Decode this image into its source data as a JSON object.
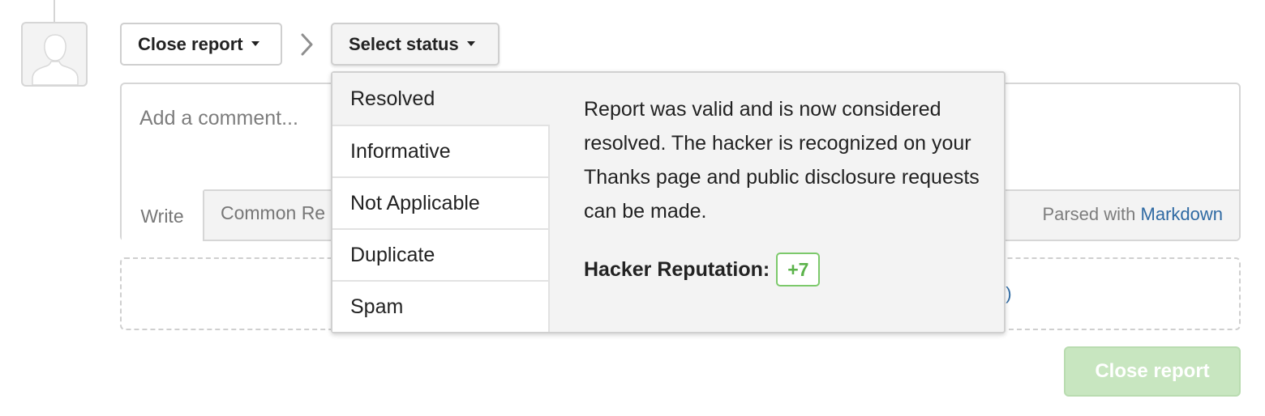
{
  "actions": {
    "close_report_label": "Close report",
    "select_status_label": "Select status"
  },
  "comment": {
    "placeholder": "Add a comment...",
    "tab_write": "Write",
    "tab_common_responses": "Common Re",
    "parsed_prefix": "Parsed with",
    "parsed_link": "Markdown"
  },
  "attachments": {
    "visible_fragment": "e)"
  },
  "status_menu": {
    "items": [
      "Resolved",
      "Informative",
      "Not Applicable",
      "Duplicate",
      "Spam"
    ],
    "selected": "Resolved",
    "description": "Report was valid and is now considered resolved. The hacker is recognized on your Thanks page and public disclosure requests can be made.",
    "reputation_label": "Hacker Reputation:",
    "reputation_value": "+7"
  },
  "footer": {
    "close_report_label": "Close report"
  },
  "colors": {
    "link": "#2f6aa3",
    "reputation_positive": "#5bb34a",
    "submit_disabled": "#c8e6c0"
  },
  "icons": {
    "avatar": "default-user-avatar",
    "breadcrumb_separator": "chevron-right-icon",
    "dropdown": "caret-down-icon"
  }
}
